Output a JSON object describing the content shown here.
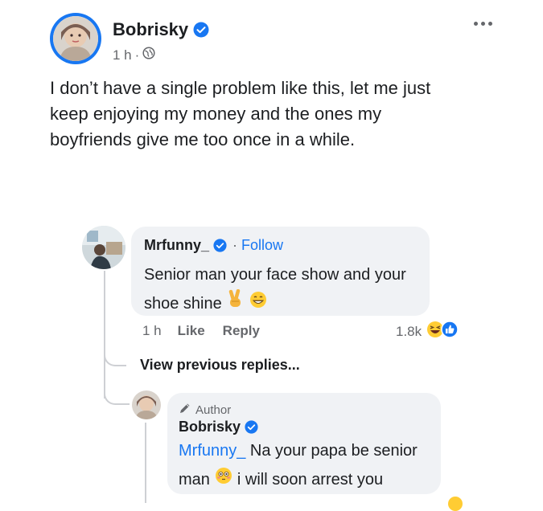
{
  "post": {
    "author_name": "Bobrisky",
    "time": "1 h",
    "separator": "·",
    "audience_icon": "globe-icon",
    "text_line1": "I don’t have a single problem like this, let me just",
    "text_line2": "keep enjoying my money and the ones my",
    "text_line3": "boyfriends give me too once in a while.",
    "more_icon": "more-options-icon"
  },
  "comment1": {
    "author": "Mrfunny_",
    "follow_prefix": "·",
    "follow_label": "Follow",
    "text_line1": "Senior man your face show and your",
    "text_line2": "shoe shine",
    "time": "1 h",
    "like_label": "Like",
    "reply_label": "Reply",
    "reaction_count": "1.8k"
  },
  "view_previous": "View previous replies...",
  "reply1": {
    "badge_label": "Author",
    "author": "Bobrisky",
    "mention": "Mrfunny_",
    "text_line1_rest": " Na your papa be senior",
    "text_line2_a": "man",
    "text_line2_b": "i will soon arrest you"
  },
  "colors": {
    "accent": "#1877f2",
    "bubble": "#f0f2f5",
    "muted": "#65676b",
    "text": "#1c1e21"
  }
}
